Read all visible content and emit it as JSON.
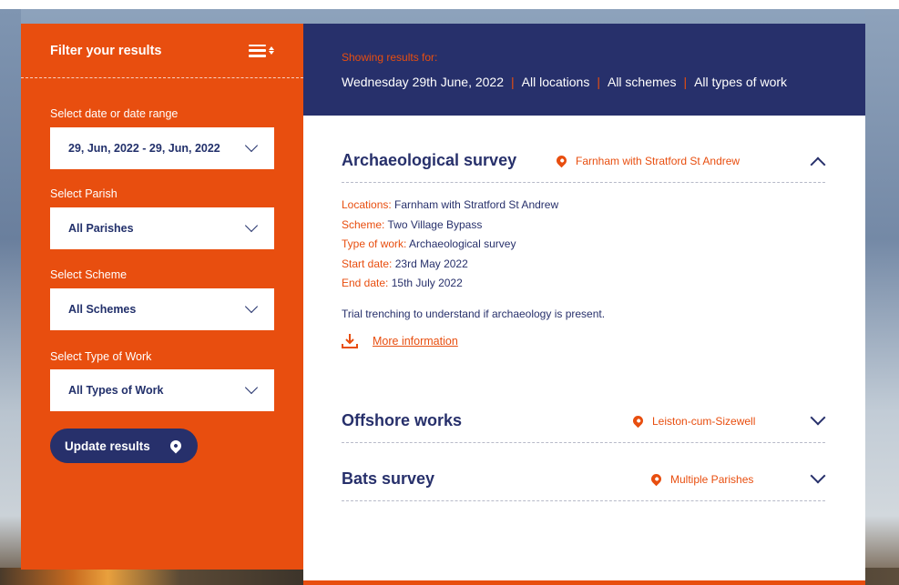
{
  "sidebar": {
    "title": "Filter your results",
    "date_label": "Select date or date range",
    "date_value": "29, Jun, 2022 - 29, Jun, 2022",
    "parish_label": "Select Parish",
    "parish_value": "All Parishes",
    "scheme_label": "Select Scheme",
    "scheme_value": "All Schemes",
    "type_label": "Select Type of Work",
    "type_value": "All Types of Work",
    "update_label": "Update results"
  },
  "header": {
    "showing_label": "Showing results for:",
    "filters": [
      "Wednesday 29th June, 2022",
      "All locations",
      "All schemes",
      "All types of work"
    ],
    "separator": "|"
  },
  "results": [
    {
      "title": "Archaeological survey",
      "location": "Farnham with Stratford St Andrew",
      "expanded": true,
      "details": [
        {
          "key": "Locations:",
          "value": "Farnham with Stratford St Andrew"
        },
        {
          "key": "Scheme:",
          "value": "Two Village Bypass"
        },
        {
          "key": "Type of work:",
          "value": "Archaeological survey"
        },
        {
          "key": "Start date:",
          "value": "23rd May 2022"
        },
        {
          "key": "End date:",
          "value": "15th July 2022"
        }
      ],
      "description": "Trial trenching to understand if archaeology is present.",
      "more_link": "More information"
    },
    {
      "title": "Offshore works",
      "location": "Leiston-cum-Sizewell",
      "expanded": false
    },
    {
      "title": "Bats survey",
      "location": "Multiple Parishes",
      "expanded": false
    }
  ],
  "colors": {
    "accent": "#e84e0f",
    "navy": "#27306b",
    "panel": "#ffffff"
  },
  "icons": [
    "sort-icon",
    "chevron-down-icon",
    "chevron-up-icon",
    "location-pin-icon",
    "download-icon"
  ]
}
